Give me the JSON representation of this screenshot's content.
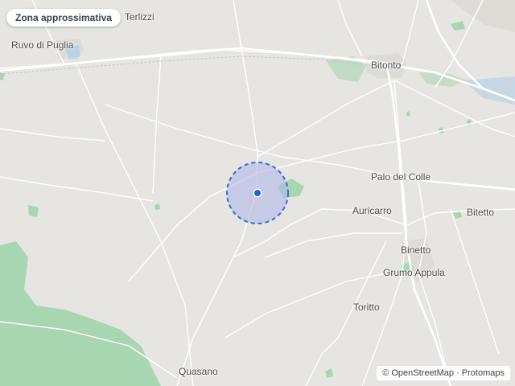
{
  "map": {
    "area_badge": "Zona approssimativa",
    "attribution": "© OpenStreetMap · Protomaps",
    "places": {
      "terlizzi": "Terlizzi",
      "ruvo": "Ruvo di Puglia",
      "bitonto": "Bitonto",
      "palo": "Palo del Colle",
      "auricarro": "Auricarro",
      "bitetto": "Bitetto",
      "binetto": "Binetto",
      "grumo": "Grumo Appula",
      "toritto": "Toritto",
      "quasano": "Quasano"
    },
    "colors": {
      "land": "#e7e5e2",
      "road": "#ffffff",
      "vegetation": "#a7d6b1",
      "water": "#b9d3e6",
      "area_fill": "#b0b8e8",
      "area_stroke": "#2f6ed8",
      "marker": "#1f62d8"
    }
  }
}
